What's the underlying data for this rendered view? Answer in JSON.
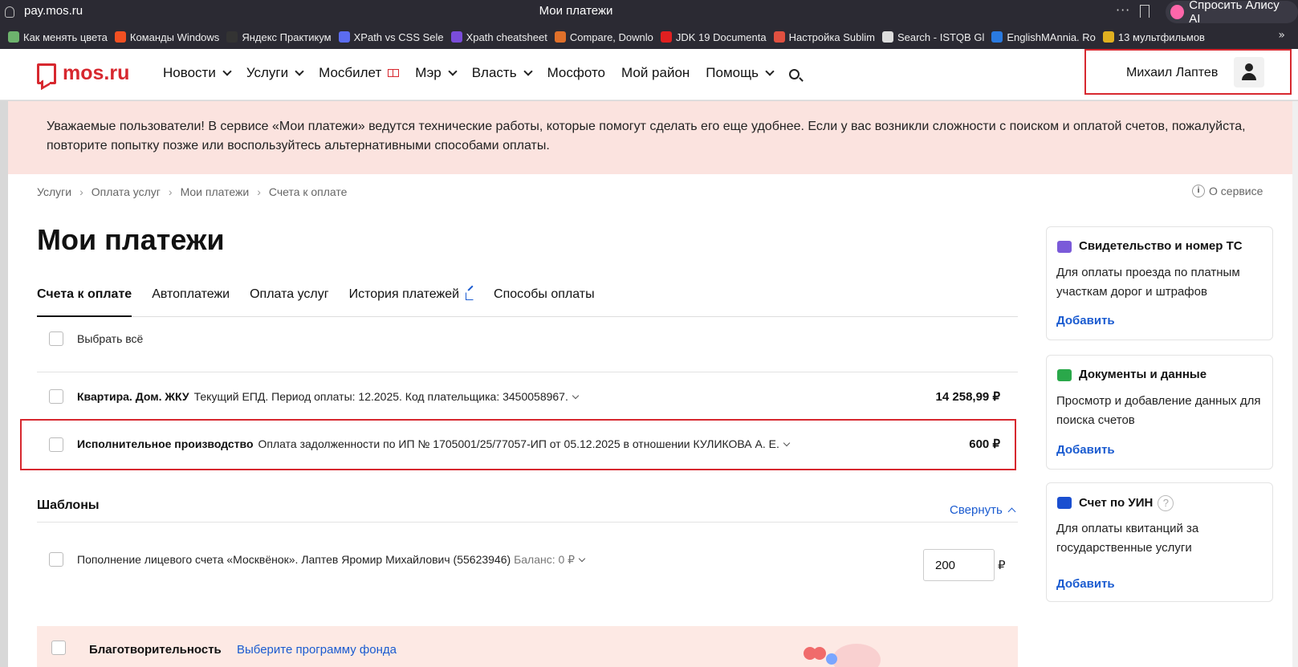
{
  "browser": {
    "url": "pay.mos.ru",
    "page_title": "Мои платежи",
    "alice_label": "Спросить Алису AI",
    "bookmarks": [
      {
        "label": "Как менять цвета",
        "color": "#6db36d"
      },
      {
        "label": "Команды Windows",
        "color": "#f25022"
      },
      {
        "label": "Яндекс Практикум",
        "color": "#333333"
      },
      {
        "label": "XPath vs CSS Sele",
        "color": "#5b6cf0"
      },
      {
        "label": "Xpath cheatsheet",
        "color": "#7a4cd9"
      },
      {
        "label": "Compare, Downlo",
        "color": "#e0702a"
      },
      {
        "label": "JDK 19 Documenta",
        "color": "#e02020"
      },
      {
        "label": "Настройка Sublim",
        "color": "#e05040"
      },
      {
        "label": "Search - ISTQB Gl",
        "color": "#dddddd"
      },
      {
        "label": "EnglishMAnnia. Ro",
        "color": "#2a7ae0"
      },
      {
        "label": "13 мультфильмов",
        "color": "#e0b020"
      }
    ]
  },
  "header": {
    "logo": "mos.ru",
    "nav": [
      {
        "label": "Новости",
        "dropdown": true
      },
      {
        "label": "Услуги",
        "dropdown": true
      },
      {
        "label": "Мосбилет",
        "dropdown": false,
        "book": true
      },
      {
        "label": "Мэр",
        "dropdown": true
      },
      {
        "label": "Власть",
        "dropdown": true
      },
      {
        "label": "Мосфото",
        "dropdown": false
      },
      {
        "label": "Мой район",
        "dropdown": false
      },
      {
        "label": "Помощь",
        "dropdown": true
      }
    ],
    "user_name": "Михаил Лаптев"
  },
  "alert": {
    "text": "Уважаемые пользователи! В сервисе «Мои платежи» ведутся технические работы, которые помогут сделать его еще удобнее. Если у вас возникли сложности с поиском и оплатой счетов, пожалуйста, повторите попытку позже или воспользуйтесь альтернативными способами оплаты."
  },
  "breadcrumb": [
    "Услуги",
    "Оплата услуг",
    "Мои платежи",
    "Счета к оплате"
  ],
  "about_service": "О сервисе",
  "page_title": "Мои платежи",
  "tabs": [
    {
      "label": "Счета к оплате",
      "active": true
    },
    {
      "label": "Автоплатежи",
      "active": false
    },
    {
      "label": "Оплата услуг",
      "active": false
    },
    {
      "label": "История платежей",
      "active": false,
      "external": true
    },
    {
      "label": "Способы оплаты",
      "active": false
    }
  ],
  "select_all": "Выбрать всё",
  "bills": [
    {
      "title": "Квартира. Дом. ЖКУ",
      "description": "Текущий ЕПД. Период оплаты: 12.2025. Код плательщика: 3450058967.",
      "amount": "14 258,99 ₽"
    },
    {
      "title": "Исполнительное производство",
      "description": "Оплата задолженности по ИП № 1705001/25/77057-ИП от 05.12.2025 в отношении КУЛИКОВА А. Е.",
      "amount": "600 ₽"
    }
  ],
  "templates": {
    "title": "Шаблоны",
    "collapse_label": "Свернуть",
    "items": [
      {
        "description": "Пополнение лицевого счета «Москвёнок». Лаптев Яромир Михайлович (55623946)",
        "balance": "Баланс: 0 ₽",
        "amount_value": "200",
        "currency": "₽"
      }
    ]
  },
  "charity": {
    "title": "Благотворительность",
    "link": "Выберите программу фонда"
  },
  "cards": [
    {
      "title": "Свидетельство и номер ТС",
      "description": "Для оплаты проезда по платным участкам дорог и штрафов",
      "action": "Добавить",
      "icon": "car-icon",
      "icon_color": "#7a5ad9"
    },
    {
      "title": "Документы и данные",
      "description": "Просмотр и добавление данных для поиска счетов",
      "action": "Добавить",
      "icon": "documents-icon",
      "icon_color": "#2aa84a"
    },
    {
      "title": "Счет по УИН",
      "description": "Для оплаты квитанций за государственные услуги",
      "action": "Добавить",
      "icon": "receipt-icon",
      "icon_color": "#1a4fd0",
      "help": "?"
    }
  ]
}
